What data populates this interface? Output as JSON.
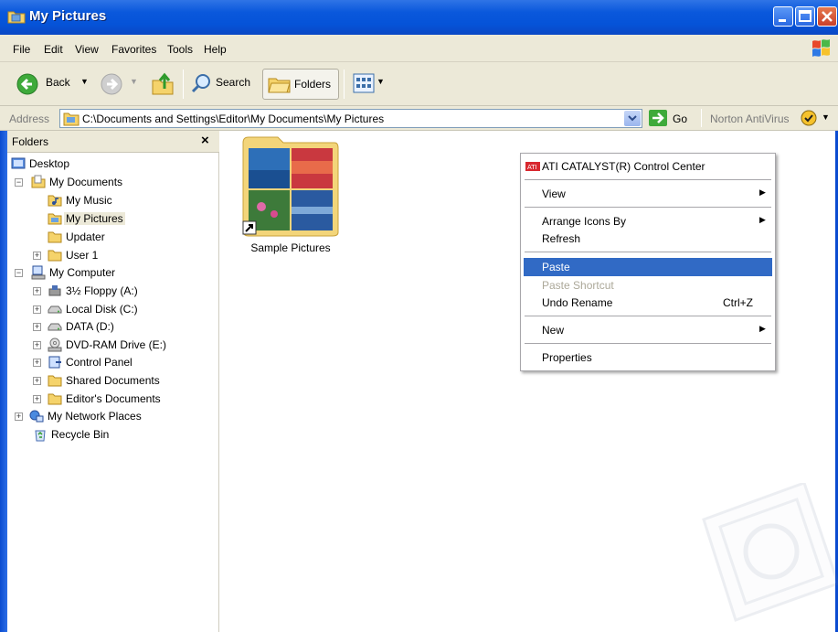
{
  "window": {
    "title": "My Pictures"
  },
  "menu": [
    "File",
    "Edit",
    "View",
    "Favorites",
    "Tools",
    "Help"
  ],
  "toolbar": {
    "back_label": "Back",
    "search_label": "Search",
    "folders_label": "Folders"
  },
  "address": {
    "label": "Address",
    "path": "C:\\Documents and Settings\\Editor\\My Documents\\My Pictures",
    "go_label": "Go",
    "norton_label": "Norton AntiVirus"
  },
  "folders_pane": {
    "title": "Folders",
    "close_glyph": "×",
    "tree": [
      {
        "label": "Desktop",
        "icon": "desktop-icon"
      },
      {
        "label": "My Documents",
        "icon": "my-documents-icon"
      },
      {
        "label": "My Music",
        "icon": "music-folder-icon"
      },
      {
        "label": "My Pictures",
        "icon": "pictures-folder-icon",
        "selected": true
      },
      {
        "label": "Updater",
        "icon": "folder-icon"
      },
      {
        "label": "User 1",
        "icon": "folder-icon"
      },
      {
        "label": "My Computer",
        "icon": "computer-icon"
      },
      {
        "label": "3½ Floppy (A:)",
        "icon": "floppy-icon"
      },
      {
        "label": "Local Disk (C:)",
        "icon": "drive-icon"
      },
      {
        "label": "DATA (D:)",
        "icon": "drive-icon"
      },
      {
        "label": "DVD-RAM Drive (E:)",
        "icon": "dvd-icon"
      },
      {
        "label": "Control Panel",
        "icon": "control-panel-icon"
      },
      {
        "label": "Shared Documents",
        "icon": "folder-icon"
      },
      {
        "label": "Editor's Documents",
        "icon": "folder-icon"
      },
      {
        "label": "My Network Places",
        "icon": "network-icon"
      },
      {
        "label": "Recycle Bin",
        "icon": "recycle-bin-icon"
      }
    ]
  },
  "content": {
    "items": [
      {
        "label": "Sample Pictures",
        "icon": "shortcut-folder-icon"
      }
    ]
  },
  "context_menu": {
    "items": [
      {
        "label": "ATI CATALYST(R) Control Center"
      },
      {
        "label": "View"
      },
      {
        "label": "Arrange Icons By"
      },
      {
        "label": "Refresh"
      },
      {
        "label": "Paste",
        "highlighted": true
      },
      {
        "label": "Paste Shortcut",
        "disabled": true
      },
      {
        "label": "Undo Rename",
        "shortcut": "Ctrl+Z"
      },
      {
        "label": "New"
      },
      {
        "label": "Properties"
      }
    ]
  },
  "colors": {
    "titlebar": "#0553d8",
    "highlight": "#316ac5",
    "chrome": "#ece9d8"
  }
}
